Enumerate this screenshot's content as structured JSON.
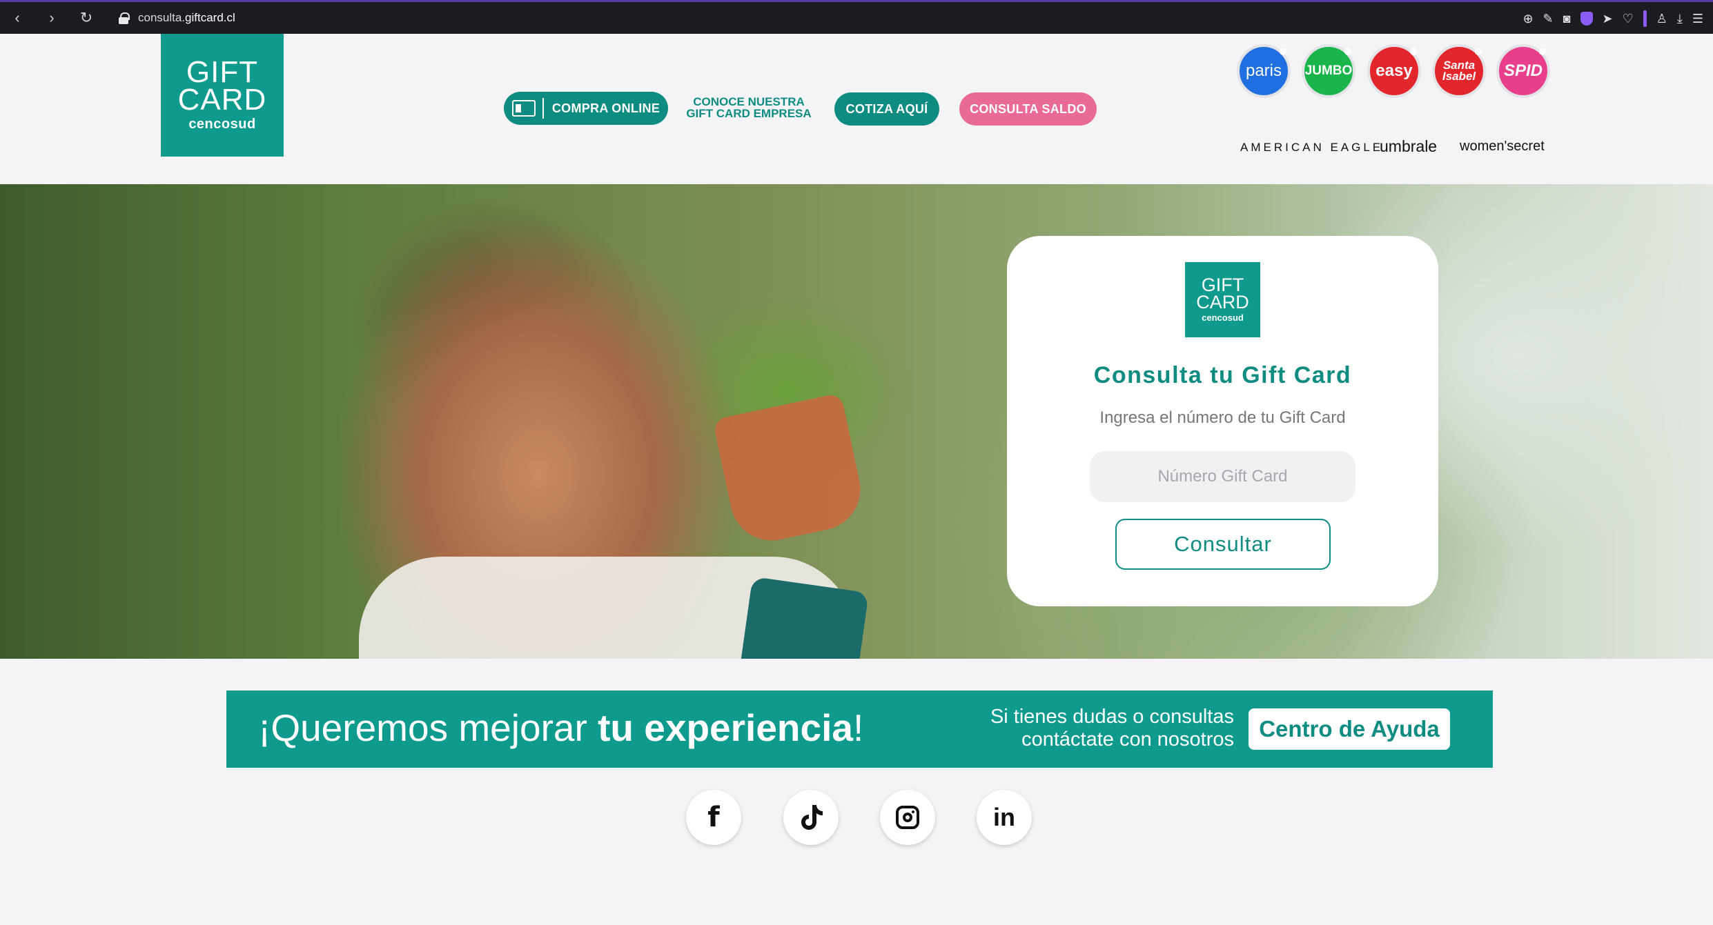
{
  "browser": {
    "url_prefix": "consulta.",
    "url_domain": "giftcard.cl"
  },
  "header": {
    "logo": {
      "line1": "GIFT",
      "line2": "CARD",
      "line3": "cencosud"
    },
    "nav": {
      "compra_online": "COMPRA ONLINE",
      "empresa_line1": "CONOCE NUESTRA",
      "empresa_line2": "GIFT CARD EMPRESA",
      "cotiza": "COTIZA AQUÍ",
      "consulta_saldo": "CONSULTA SALDO"
    },
    "brands": {
      "paris": "paris",
      "jumbo": "JUMBO",
      "easy": "easy",
      "santa_isabel_1": "Santa",
      "santa_isabel_2": "Isabel",
      "spid": "SPID",
      "american_eagle": "AMERICAN EAGLE",
      "umbrale": "umbrale",
      "womensecret": "women'secret"
    }
  },
  "consulta_card": {
    "logo": {
      "line1": "GIFT",
      "line2": "CARD",
      "line3": "cencosud"
    },
    "title": "Consulta tu Gift Card",
    "subtitle": "Ingresa el número de tu Gift Card",
    "input_placeholder": "Número Gift Card",
    "input_value": "",
    "submit_label": "Consultar"
  },
  "banner": {
    "headline_prefix": "¡Queremos mejorar ",
    "headline_bold": "tu experiencia",
    "headline_suffix": "!",
    "help_line1": "Si tienes dudas o consultas",
    "help_line2": "contáctate con nosotros",
    "help_button": "Centro de Ayuda"
  },
  "social": {
    "facebook": "f",
    "linkedin": "in"
  },
  "colors": {
    "brand_teal": "#0f9a8e",
    "pink": "#ea6a97"
  }
}
